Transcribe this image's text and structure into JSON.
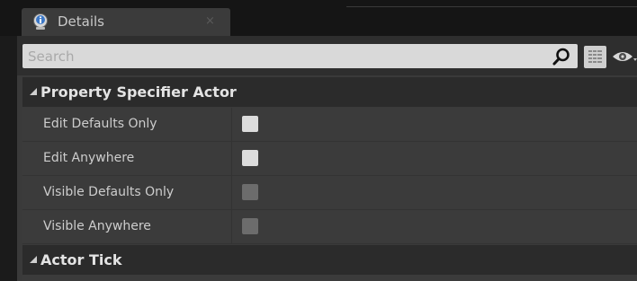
{
  "tab": {
    "title": "Details",
    "close_glyph": "×",
    "icon": "details-info-icon"
  },
  "search": {
    "placeholder": "Search",
    "value": "",
    "search_icon": "search-icon",
    "view_options_icon": "grid-icon",
    "visibility_icon": "eye-icon"
  },
  "categories": [
    {
      "label": "Property Specifier Actor",
      "expanded": true,
      "properties": [
        {
          "label": "Edit Defaults Only",
          "checked": false,
          "enabled": true
        },
        {
          "label": "Edit Anywhere",
          "checked": false,
          "enabled": true
        },
        {
          "label": "Visible Defaults Only",
          "checked": false,
          "enabled": false
        },
        {
          "label": "Visible Anywhere",
          "checked": false,
          "enabled": false
        }
      ]
    },
    {
      "label": "Actor Tick",
      "expanded": true,
      "properties": []
    }
  ],
  "colors": {
    "panel_bg": "#3a3a3a",
    "header_bg": "#2b2b2b",
    "checkbox_enabled": "#dcdcdc",
    "checkbox_disabled": "#6c6c6c",
    "search_bg": "#d9d9d9"
  }
}
